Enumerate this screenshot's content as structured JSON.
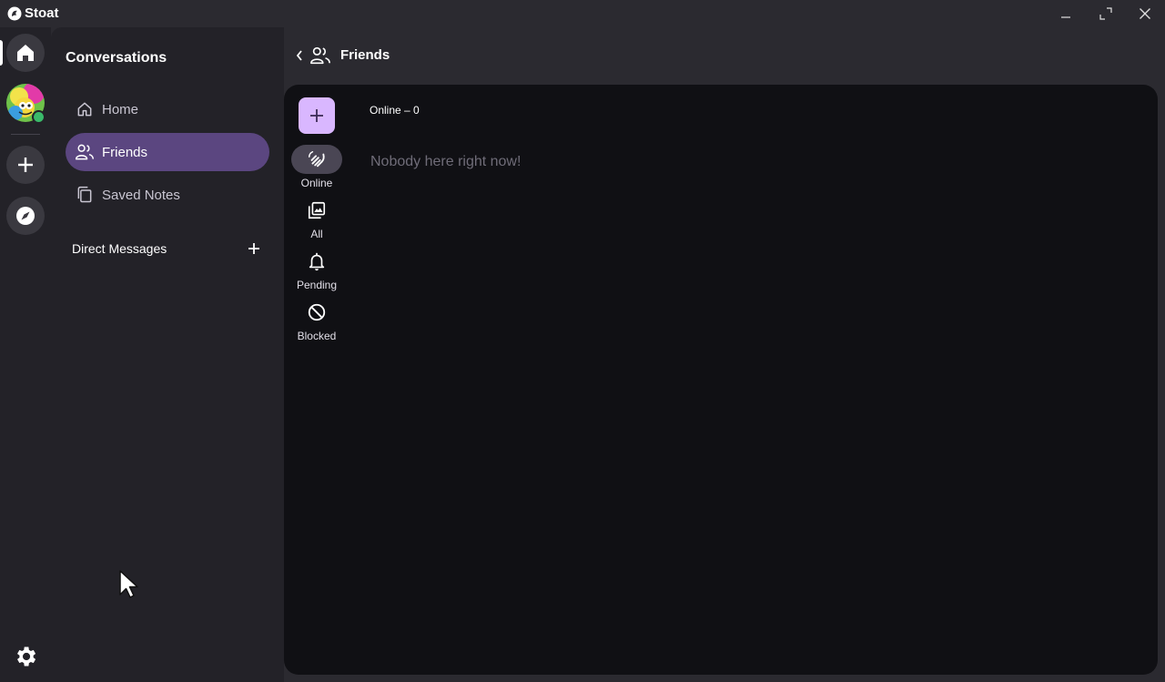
{
  "app": {
    "title": "Stoat"
  },
  "sidebar": {
    "title": "Conversations",
    "items": [
      {
        "label": "Home",
        "icon": "home-icon",
        "active": false
      },
      {
        "label": "Friends",
        "icon": "friends-icon",
        "active": true
      },
      {
        "label": "Saved Notes",
        "icon": "notes-icon",
        "active": false
      }
    ],
    "dm_label": "Direct Messages"
  },
  "header": {
    "title": "Friends"
  },
  "friends": {
    "tabs": [
      {
        "label": "Online",
        "icon": "wave-icon",
        "active": true
      },
      {
        "label": "All",
        "icon": "library-icon",
        "active": false
      },
      {
        "label": "Pending",
        "icon": "bell-icon",
        "active": false
      },
      {
        "label": "Blocked",
        "icon": "block-icon",
        "active": false
      }
    ],
    "section_title": "Online – 0",
    "empty_message": "Nobody here right now!"
  },
  "colors": {
    "accent": "#5b4680",
    "add_button": "#d9b7ff",
    "online_status": "#3aba6a"
  }
}
